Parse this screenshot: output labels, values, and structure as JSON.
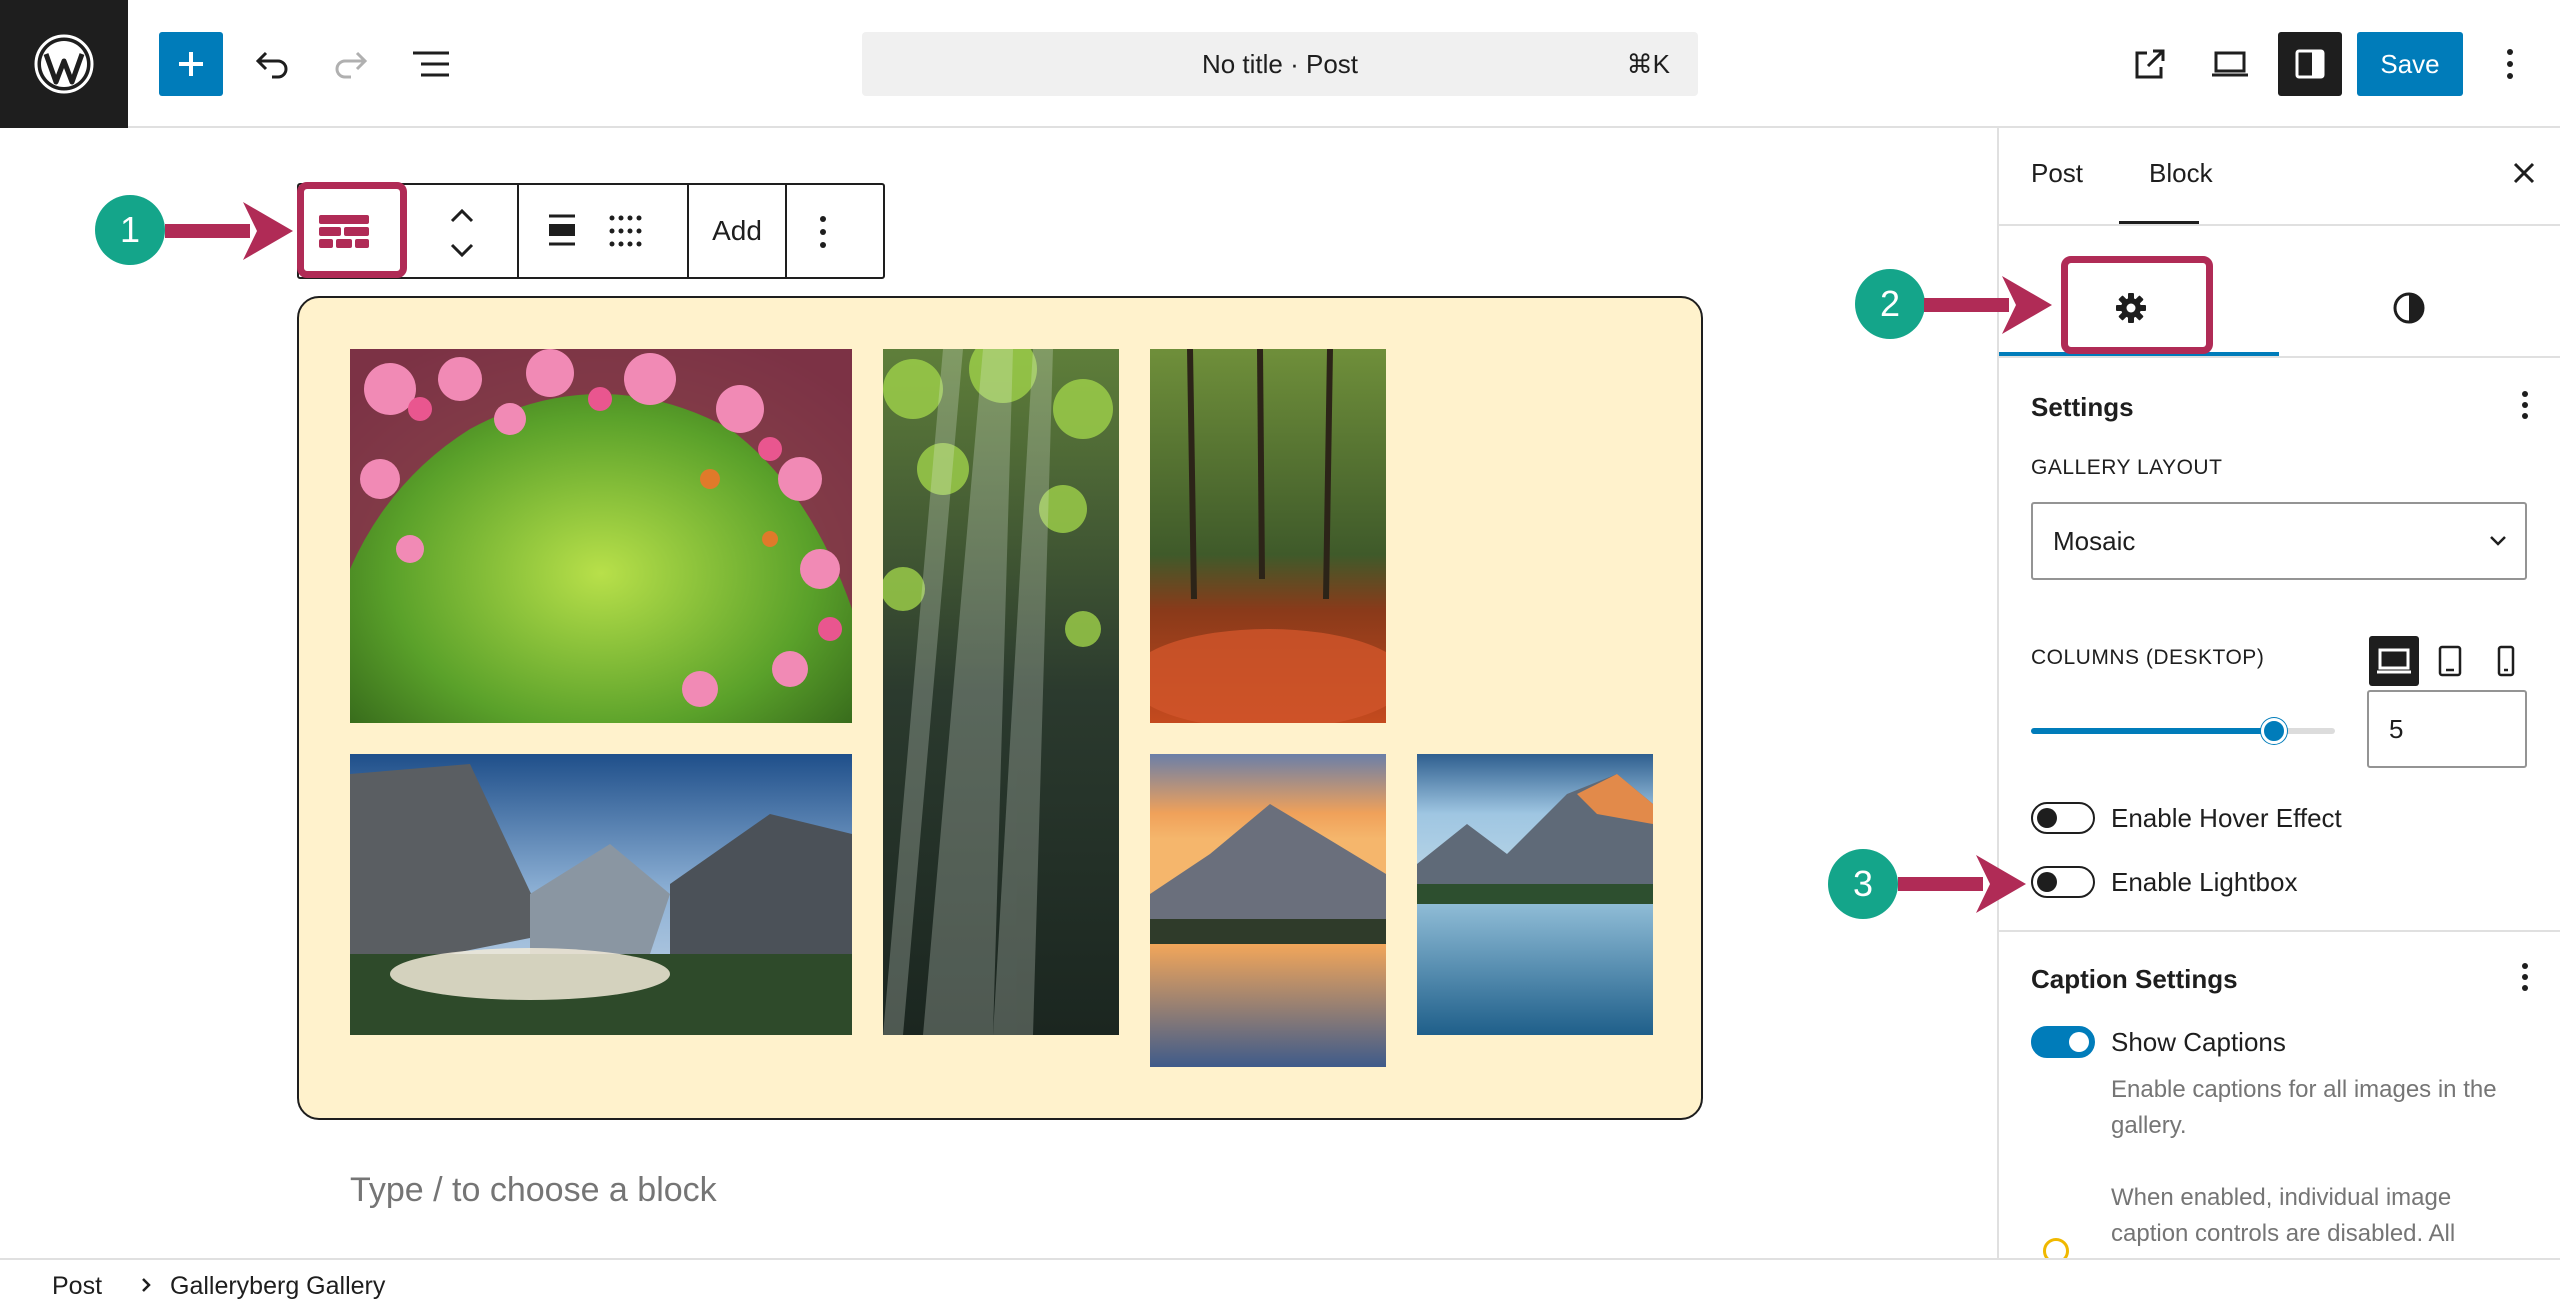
{
  "topbar": {
    "title": "No title · Post",
    "shortcut": "⌘K",
    "save_label": "Save"
  },
  "block_toolbar": {
    "add_label": "Add"
  },
  "sidebar": {
    "tabs": [
      "Post",
      "Block"
    ],
    "settings": {
      "title": "Settings",
      "gallery_layout_label": "GALLERY LAYOUT",
      "gallery_layout_value": "Mosaic",
      "columns_label": "COLUMNS (DESKTOP)",
      "columns_value": "5",
      "columns_slider_fraction": 0.8,
      "hover_label": "Enable Hover Effect",
      "hover_on": false,
      "lightbox_label": "Enable Lightbox",
      "lightbox_on": false
    },
    "captions": {
      "title": "Caption Settings",
      "show_label": "Show Captions",
      "show_on": true,
      "help1": "Enable captions for all images in the gallery.",
      "help2": "When enabled, individual image caption controls are disabled. All"
    }
  },
  "editor": {
    "placeholder": "Type / to choose a block"
  },
  "breadcrumb": [
    "Post",
    "Galleryberg Gallery"
  ],
  "callouts": [
    "1",
    "2",
    "3"
  ],
  "colors": {
    "accent": "#007cba",
    "callout": "#14a58a",
    "highlight": "#b02b56",
    "gallery_bg": "#fff2cc"
  }
}
